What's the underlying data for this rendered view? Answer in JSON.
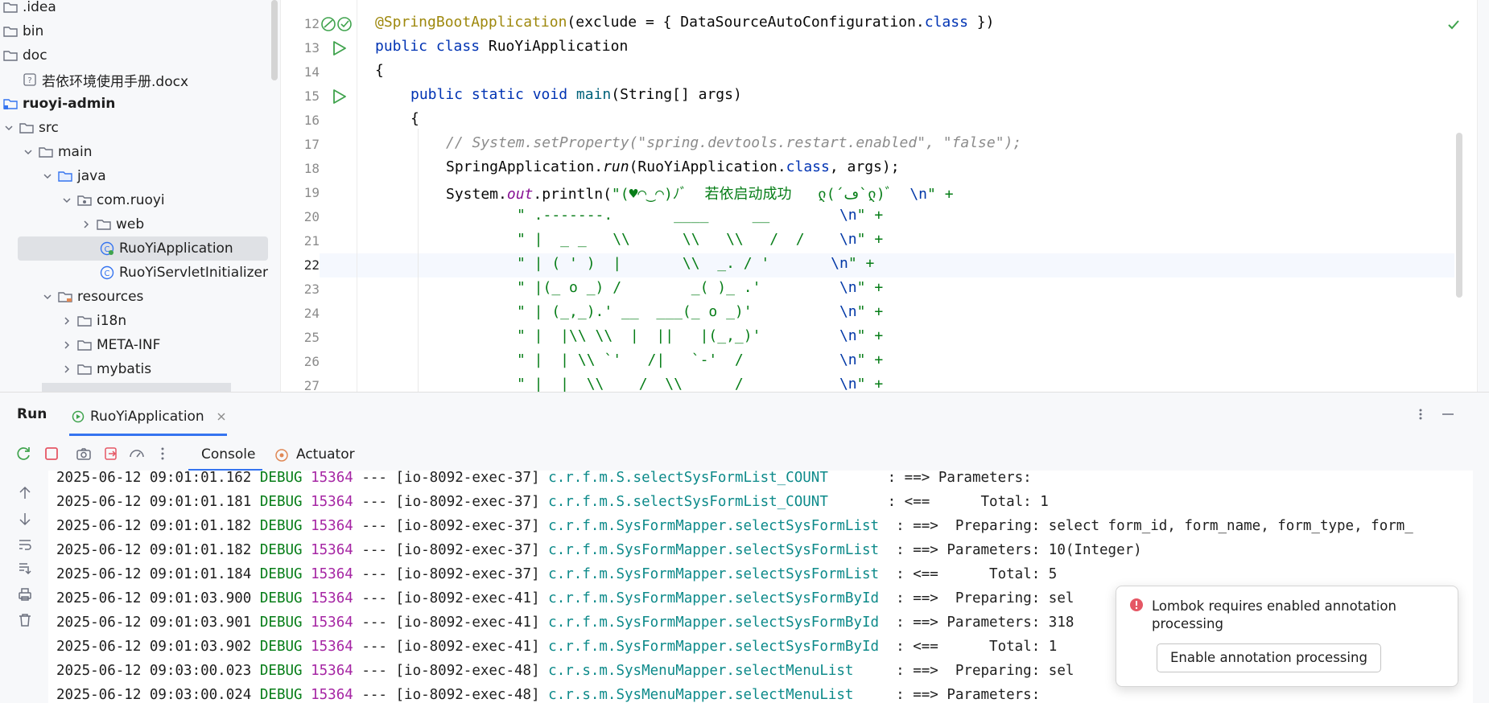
{
  "tree": {
    "items": [
      {
        "label": ".idea",
        "type": "folder",
        "expanded": null
      },
      {
        "label": "bin",
        "type": "folder",
        "expanded": null
      },
      {
        "label": "doc",
        "type": "folder",
        "expanded": null
      },
      {
        "label": "若依环境使用手册.docx",
        "type": "file-unknown",
        "expanded": null
      },
      {
        "label": "ruoyi-admin",
        "type": "module",
        "expanded": null
      },
      {
        "label": "src",
        "type": "folder",
        "expanded": true
      },
      {
        "label": "main",
        "type": "folder",
        "expanded": true
      },
      {
        "label": "java",
        "type": "source-folder",
        "expanded": true
      },
      {
        "label": "com.ruoyi",
        "type": "package",
        "expanded": true
      },
      {
        "label": "web",
        "type": "folder",
        "expanded": false
      },
      {
        "label": "RuoYiApplication",
        "type": "class-spring",
        "expanded": null
      },
      {
        "label": "RuoYiServletInitializer",
        "type": "class",
        "expanded": null
      },
      {
        "label": "resources",
        "type": "resources-folder",
        "expanded": true
      },
      {
        "label": "i18n",
        "type": "folder",
        "expanded": false
      },
      {
        "label": "META-INF",
        "type": "folder",
        "expanded": false
      },
      {
        "label": "mybatis",
        "type": "folder",
        "expanded": false
      }
    ],
    "selected_index": 10
  },
  "editor": {
    "line_numbers": [
      "12",
      "13",
      "14",
      "15",
      "16",
      "17",
      "18",
      "19",
      "20",
      "21",
      "22",
      "23",
      "24",
      "25",
      "26",
      "27"
    ],
    "current_line": "22",
    "lines": {
      "l12a": "@SpringBootApplication",
      "l12b": "(exclude = { DataSourceAutoConfiguration.",
      "l12c": "class",
      "l12d": " })",
      "l13a": "public class",
      "l13b": " RuoYiApplication",
      "l14": "{",
      "l15a": "public static void",
      "l15b": " main",
      "l15c": "(String[] args)",
      "l16": "{",
      "l17": "// System.setProperty(\"spring.devtools.restart.enabled\", \"false\");",
      "l18a": "SpringApplication.",
      "l18b": "run",
      "l18c": "(RuoYiApplication.",
      "l18d": "class",
      "l18e": ", args);",
      "l19a": "System.",
      "l19b": "out",
      "l19c": ".println(",
      "l19d": "\"(♥◠‿◠)ﾉﾞ  若依启动成功   ლ(´ڡ`ლ)ﾞ  ",
      "l19e": "\\n",
      "l19f": "\" +",
      "art": [
        {
          "s": "\" .-------.       ____     __        ",
          "e": "\\n",
          "t": "\" +"
        },
        {
          "s": "\" |  _ _   \\\\      \\\\   \\\\   /  /    ",
          "e": "\\n",
          "t": "\" +"
        },
        {
          "s": "\" | ( ' )  |       \\\\  _. / '       ",
          "e": "\\n",
          "t": "\" +"
        },
        {
          "s": "\" |(_ o _) /        _( )_ .'         ",
          "e": "\\n",
          "t": "\" +"
        },
        {
          "s": "\" | (_,_).' __  ___(_ o _)'          ",
          "e": "\\n",
          "t": "\" +"
        },
        {
          "s": "\" |  |\\\\ \\\\  |  ||   |(_,_)'         ",
          "e": "\\n",
          "t": "\" +"
        },
        {
          "s": "\" |  | \\\\ `'   /|   `-'  /           ",
          "e": "\\n",
          "t": "\" +"
        },
        {
          "s": "\" |  |  \\\\    /  \\\\      /           ",
          "e": "\\n",
          "t": "\" +"
        }
      ]
    }
  },
  "run_panel": {
    "title": "Run",
    "tab_label": "RuoYiApplication",
    "subtabs": {
      "console": "Console",
      "actuator": "Actuator"
    },
    "log_lines": [
      {
        "ts": "2025-06-12 09:01:01.162",
        "level": "DEBUG",
        "pid": "15364",
        "sep": "---",
        "thread": "[io-8092-exec-37]",
        "logger": "c.r.f.m.S.selectSysFormList_COUNT",
        "msg": "       : ==> Parameters: "
      },
      {
        "ts": "2025-06-12 09:01:01.181",
        "level": "DEBUG",
        "pid": "15364",
        "sep": "---",
        "thread": "[io-8092-exec-37]",
        "logger": "c.r.f.m.S.selectSysFormList_COUNT",
        "msg": "       : <==      Total: 1"
      },
      {
        "ts": "2025-06-12 09:01:01.182",
        "level": "DEBUG",
        "pid": "15364",
        "sep": "---",
        "thread": "[io-8092-exec-37]",
        "logger": "c.r.f.m.SysFormMapper.selectSysFormList",
        "msg": "  : ==>  Preparing: select form_id, form_name, form_type, form_"
      },
      {
        "ts": "2025-06-12 09:01:01.182",
        "level": "DEBUG",
        "pid": "15364",
        "sep": "---",
        "thread": "[io-8092-exec-37]",
        "logger": "c.r.f.m.SysFormMapper.selectSysFormList",
        "msg": "  : ==> Parameters: 10(Integer)"
      },
      {
        "ts": "2025-06-12 09:01:01.184",
        "level": "DEBUG",
        "pid": "15364",
        "sep": "---",
        "thread": "[io-8092-exec-37]",
        "logger": "c.r.f.m.SysFormMapper.selectSysFormList",
        "msg": "  : <==      Total: 5"
      },
      {
        "ts": "2025-06-12 09:01:03.900",
        "level": "DEBUG",
        "pid": "15364",
        "sep": "---",
        "thread": "[io-8092-exec-41]",
        "logger": "c.r.f.m.SysFormMapper.selectSysFormById",
        "msg": "  : ==>  Preparing: sel"
      },
      {
        "ts": "2025-06-12 09:01:03.901",
        "level": "DEBUG",
        "pid": "15364",
        "sep": "---",
        "thread": "[io-8092-exec-41]",
        "logger": "c.r.f.m.SysFormMapper.selectSysFormById",
        "msg": "  : ==> Parameters: 318"
      },
      {
        "ts": "2025-06-12 09:01:03.902",
        "level": "DEBUG",
        "pid": "15364",
        "sep": "---",
        "thread": "[io-8092-exec-41]",
        "logger": "c.r.f.m.SysFormMapper.selectSysFormById",
        "msg": "  : <==      Total: 1"
      },
      {
        "ts": "2025-06-12 09:03:00.023",
        "level": "DEBUG",
        "pid": "15364",
        "sep": "---",
        "thread": "[io-8092-exec-48]",
        "logger": "c.r.s.m.SysMenuMapper.selectMenuList",
        "msg": "     : ==>  Preparing: sel"
      },
      {
        "ts": "2025-06-12 09:03:00.024",
        "level": "DEBUG",
        "pid": "15364",
        "sep": "---",
        "thread": "[io-8092-exec-48]",
        "logger": "c.r.s.m.SysMenuMapper.selectMenuList",
        "msg": "     : ==> Parameters: "
      }
    ]
  },
  "notification": {
    "message": "Lombok requires enabled annotation processing",
    "button": "Enable annotation processing"
  },
  "colors": {
    "accent": "#3574f0",
    "error": "#e55765",
    "run_green": "#3fa34d"
  }
}
